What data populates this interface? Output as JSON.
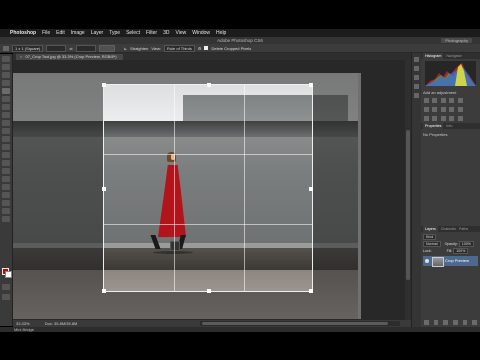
{
  "menubar": {
    "apple": "",
    "items": [
      "Photoshop",
      "File",
      "Edit",
      "Image",
      "Layer",
      "Type",
      "Select",
      "Filter",
      "3D",
      "View",
      "Window",
      "Help"
    ]
  },
  "window": {
    "title": "Adobe Photoshop CS6",
    "workspace": "Photography"
  },
  "options": {
    "ratio": "1 x 1 (Square)",
    "field1": "",
    "field2": "",
    "straighten": "Straighten",
    "view": "View:",
    "delete_label": "Rule of Thirds",
    "cropped_pixels": "Delete Cropped Pixels"
  },
  "document": {
    "tab_label": "07_Crop Tool.jpg @ 33.3% (Crop Preview, RGB/8*)",
    "zoom": "33.33%",
    "doc_size": "Doc: 35.8M/35.8M"
  },
  "panels": {
    "histogram_tab": "Histogram",
    "navigator_tab": "Navigator",
    "adjustments_label": "Add an adjustment",
    "properties_tab": "Properties",
    "info_tab": "Info",
    "no_properties": "No Properties",
    "layers_tab": "Layers",
    "channels_tab": "Channels",
    "paths_tab": "Paths",
    "kind": "Kind",
    "blend_mode": "Normal",
    "opacity_label": "Opacity:",
    "opacity_value": "100%",
    "lock_label": "Lock:",
    "fill_label": "Fill:",
    "fill_value": "100%",
    "layer_name": "Crop Preview"
  },
  "bottom": {
    "minibridge": "Mini Bridge"
  },
  "colors": {
    "foreground": "#cc0000",
    "background": "#ffffff",
    "layer_selected": "#4d6a8e"
  }
}
